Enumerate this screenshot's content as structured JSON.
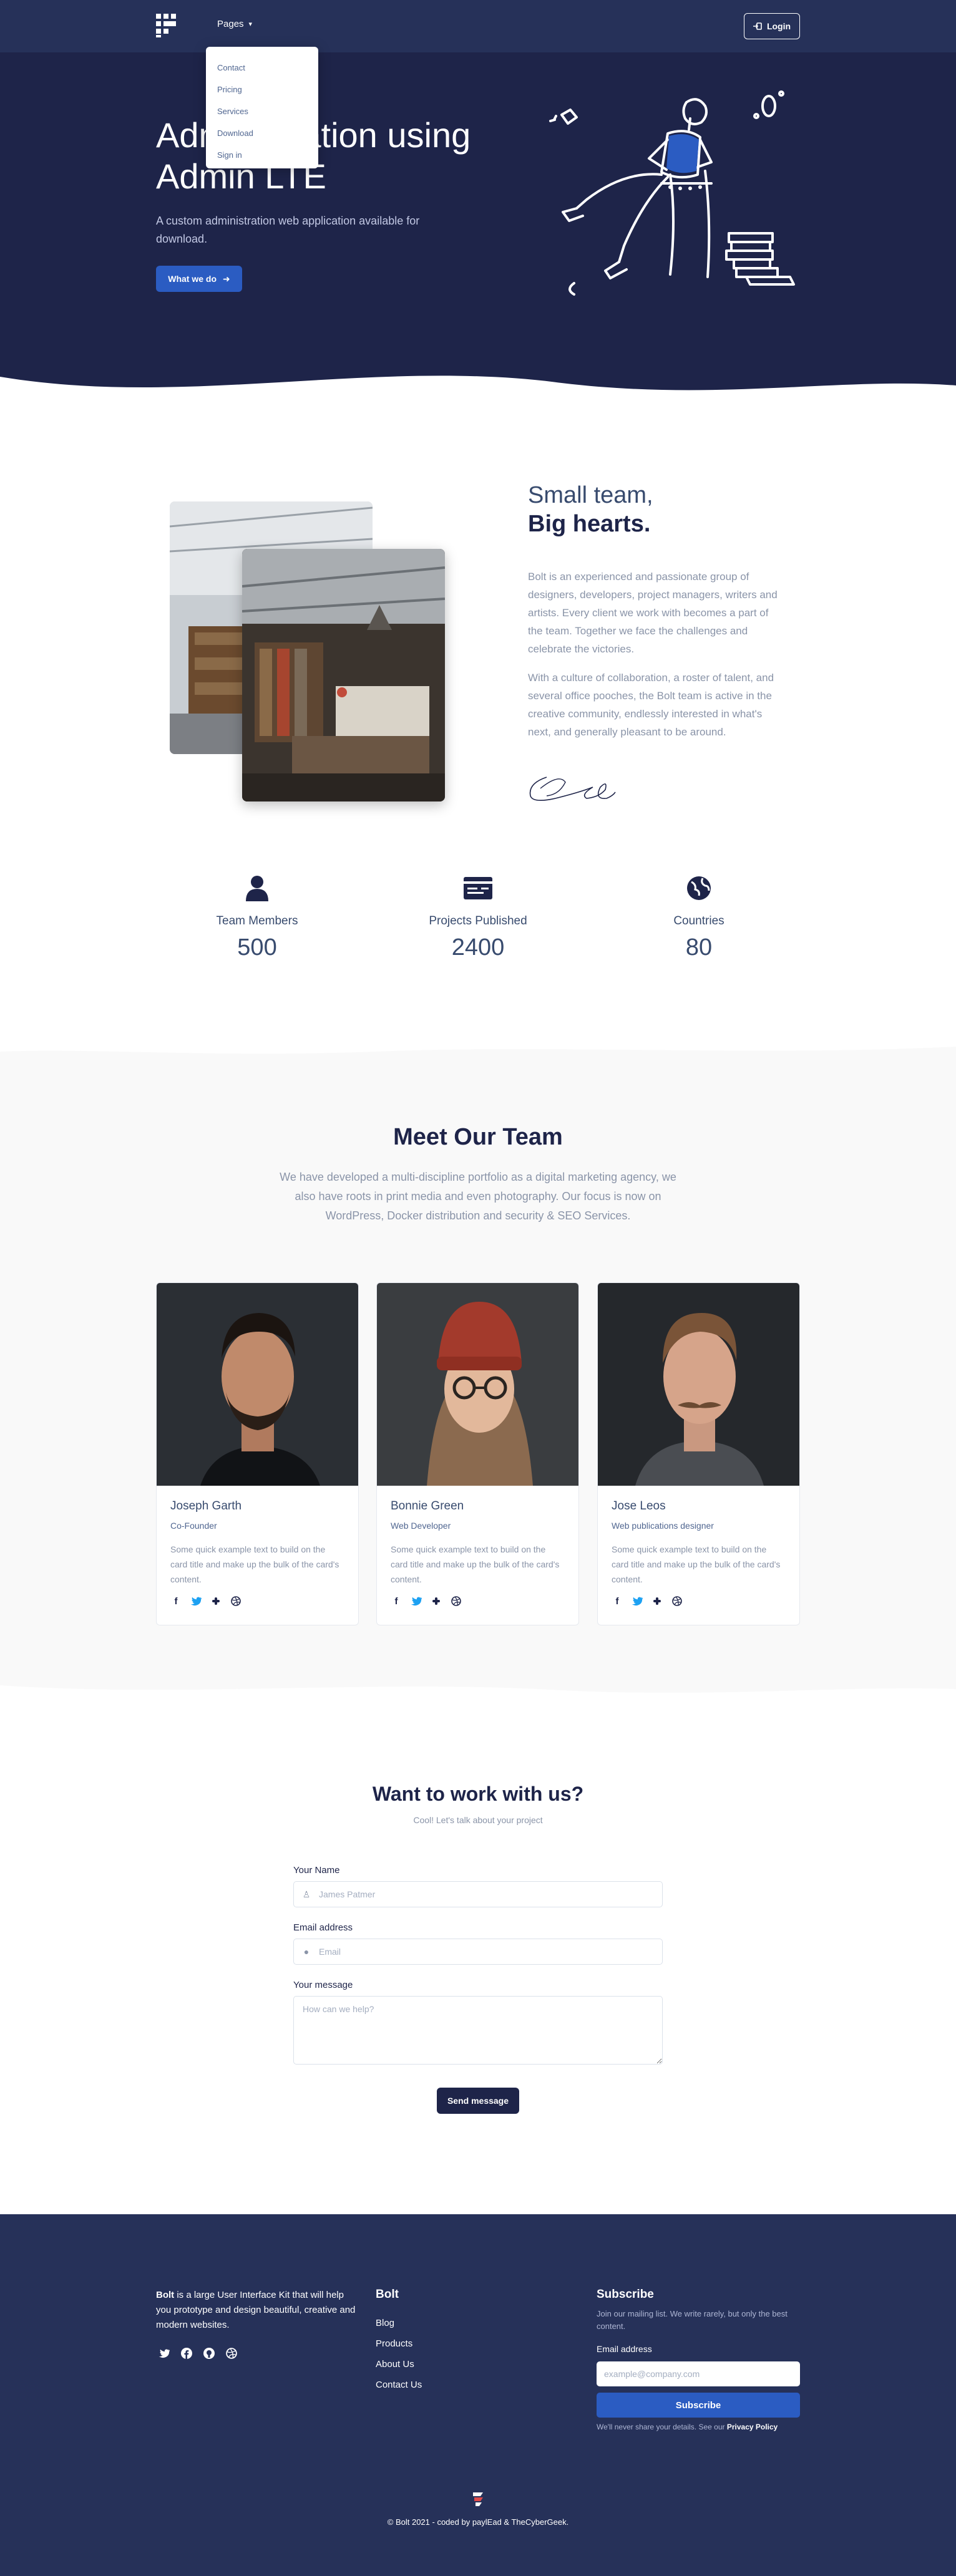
{
  "nav": {
    "pages_label": "Pages",
    "login_label": "Login",
    "dropdown": [
      "Contact",
      "Pricing",
      "Services",
      "Download",
      "Sign in"
    ]
  },
  "hero": {
    "title": "Administration using Admin LTE",
    "text": "A custom administration web application available for download.",
    "button": "What we do"
  },
  "about": {
    "heading_light": "Small team,",
    "heading_bold": "Big hearts.",
    "paragraph1": "Bolt is an experienced and passionate group of designers, developers, project managers, writers and artists. Every client we work with becomes a part of the team. Together we face the challenges and celebrate the victories.",
    "paragraph2": "With a culture of collaboration, a roster of talent, and several office pooches, the Bolt team is active in the creative community, endlessly interested in what's next, and generally pleasant to be around."
  },
  "stats": [
    {
      "label": "Team Members",
      "value": "500",
      "icon": "user-icon"
    },
    {
      "label": "Projects Published",
      "value": "2400",
      "icon": "id-card-icon"
    },
    {
      "label": "Countries",
      "value": "80",
      "icon": "globe-icon"
    }
  ],
  "team": {
    "title": "Meet Our Team",
    "description": "We have developed a multi-discipline portfolio as a digital marketing agency, we also have roots in print media and even photography. Our focus is now on WordPress, Docker distribution and security & SEO Services.",
    "members": [
      {
        "name": "Joseph Garth",
        "role": "Co-Founder",
        "text": "Some quick example text to build on the card title and make up the bulk of the card's content."
      },
      {
        "name": "Bonnie Green",
        "role": "Web Developer",
        "text": "Some quick example text to build on the card title and make up the bulk of the card's content."
      },
      {
        "name": "Jose Leos",
        "role": "Web publications designer",
        "text": "Some quick example text to build on the card title and make up the bulk of the card's content."
      }
    ]
  },
  "contact": {
    "title": "Want to work with us?",
    "subtitle": "Cool! Let's talk about your project",
    "name_label": "Your Name",
    "name_placeholder": "James Patmer",
    "email_label": "Email address",
    "email_placeholder": "Email",
    "message_label": "Your message",
    "message_placeholder": "How can we help?",
    "send_label": "Send message"
  },
  "footer": {
    "brand": "Bolt",
    "about_rest": " is a large User Interface Kit that will help you prototype and design beautiful, creative and modern websites.",
    "links_heading": "Bolt",
    "links": [
      "Blog",
      "Products",
      "About Us",
      "Contact Us"
    ],
    "subscribe_heading": "Subscribe",
    "subscribe_text": "Join our mailing list. We write rarely, but only the best content.",
    "email_label": "Email address",
    "email_placeholder": "example@company.com",
    "subscribe_button": "Subscribe",
    "note_prefix": "We'll never share your details. See our ",
    "note_link": "Privacy Policy",
    "copyright": "© Bolt 2021 - coded by paylEad & TheCyberGeek."
  },
  "colors": {
    "navy": "#1e2449",
    "nav_bg": "#263159",
    "primary": "#2b5cc2",
    "facebook": "#1e2449",
    "twitter": "#1da1f2"
  }
}
